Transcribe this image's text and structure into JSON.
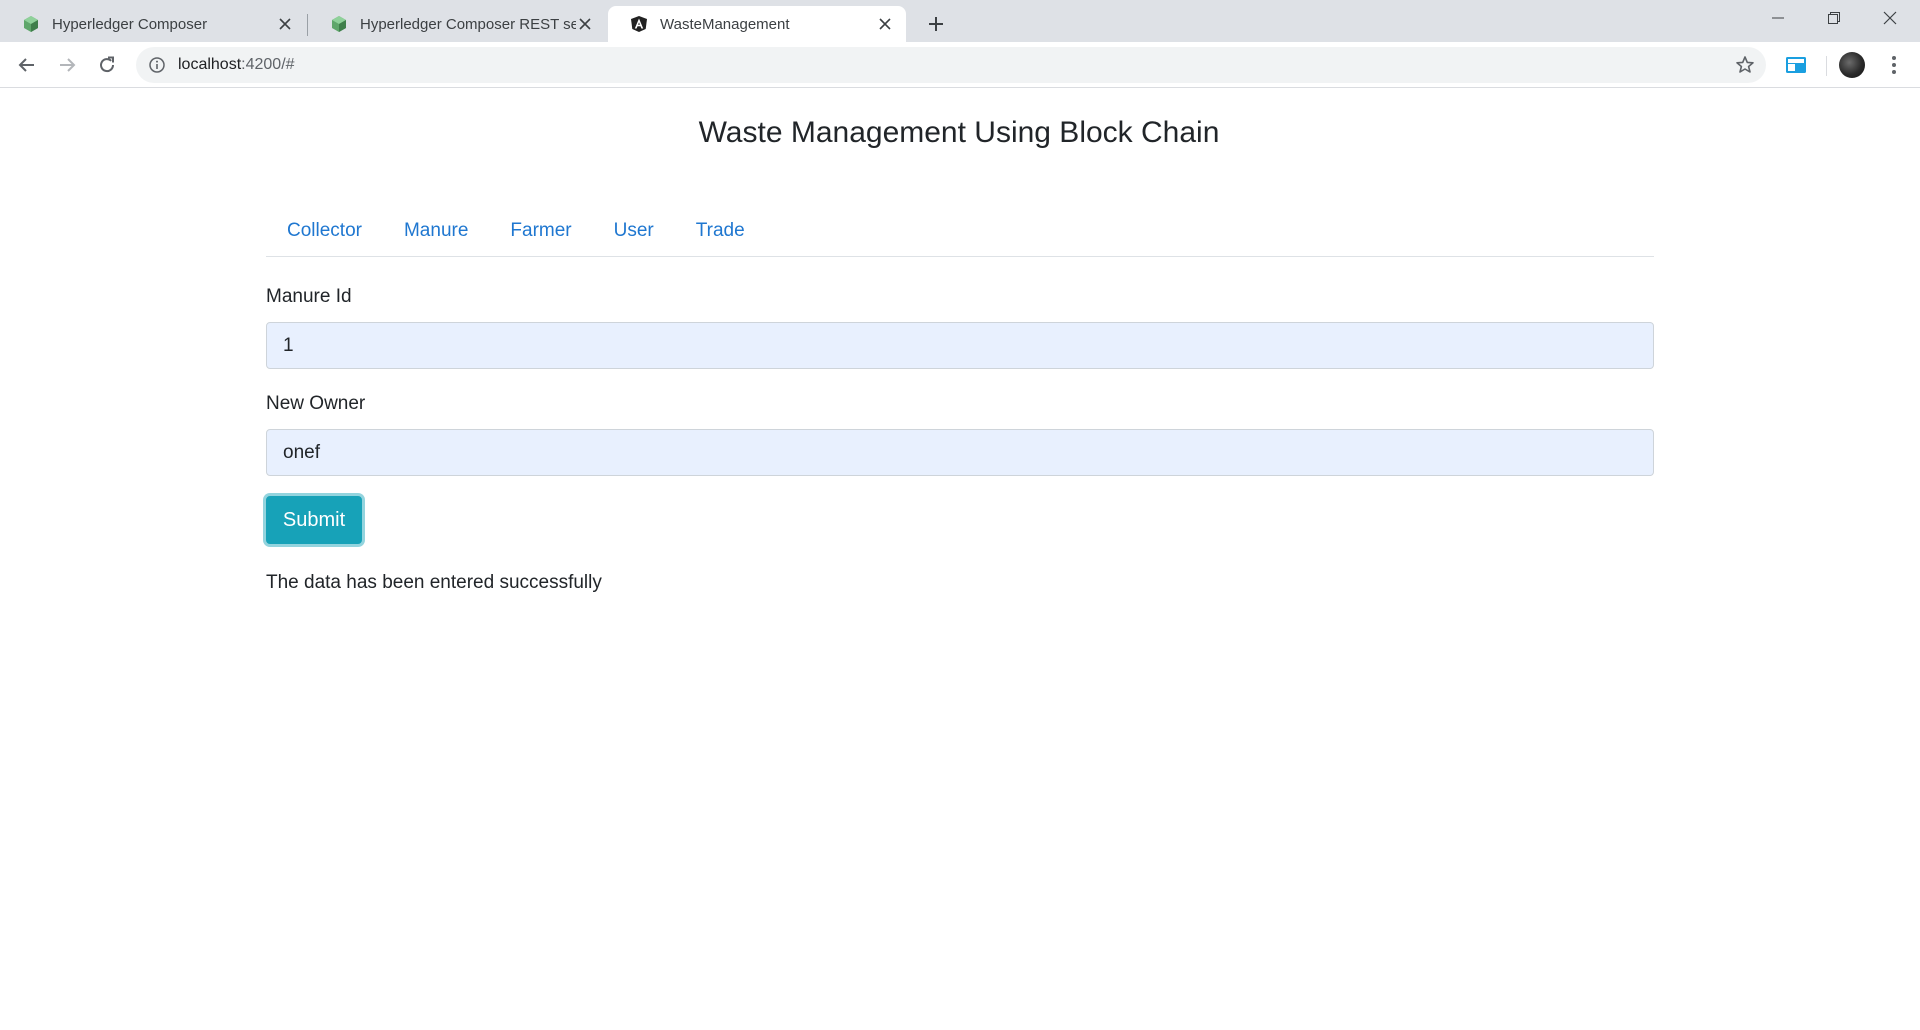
{
  "browser": {
    "tabs": [
      {
        "title": "Hyperledger Composer",
        "active": false,
        "icon": "hyperledger-cube-icon"
      },
      {
        "title": "Hyperledger Composer REST server",
        "active": false,
        "icon": "hyperledger-cube-icon"
      },
      {
        "title": "WasteManagement",
        "active": true,
        "icon": "angular-icon"
      }
    ],
    "url_host": "localhost",
    "url_rest": ":4200/#"
  },
  "page": {
    "title": "Waste Management Using Block Chain",
    "nav": [
      "Collector",
      "Manure",
      "Farmer",
      "User",
      "Trade"
    ],
    "form": {
      "manure_id_label": "Manure Id",
      "manure_id_value": "1",
      "new_owner_label": "New Owner",
      "new_owner_value": "onef",
      "submit_label": "Submit"
    },
    "message": "The data has been entered successfully"
  },
  "colors": {
    "link": "#1f77d0",
    "button": "#17a2b8",
    "autofill_bg": "#e8f0fe"
  }
}
